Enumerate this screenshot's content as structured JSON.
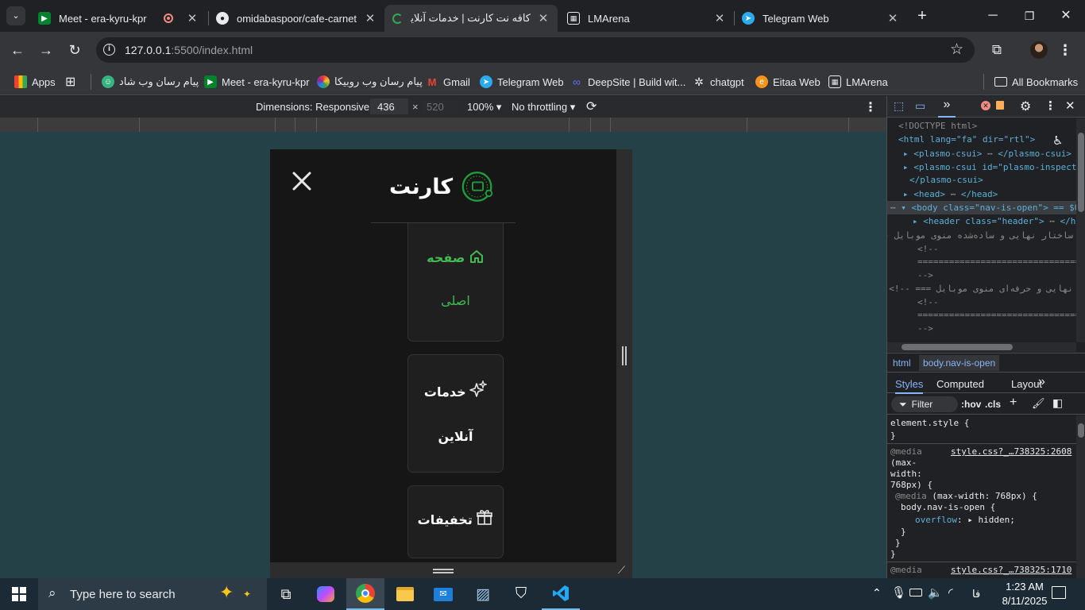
{
  "tabs": [
    {
      "title": "Meet - era-kyru-kpr",
      "icon": "google-meet-icon",
      "active": false
    },
    {
      "title": "omidabaspoor/cafe-carnet",
      "icon": "github-icon",
      "active": false
    },
    {
      "title": "کافه نت کارنت | خدمات آنلاین",
      "icon": "loading-icon",
      "active": true
    },
    {
      "title": "LMArena",
      "icon": "lmarena-icon",
      "active": false
    },
    {
      "title": "Telegram Web",
      "icon": "telegram-icon",
      "active": false
    }
  ],
  "toolbar": {
    "url_host": "127.0.0.1",
    "url_path": ":5500/index.html"
  },
  "bookmarks": {
    "apps_label": "Apps",
    "items": [
      {
        "label": "پیام رسان وب شاد",
        "icon": "shad-icon"
      },
      {
        "label": "Meet - era-kyru-kpr",
        "icon": "google-meet-icon"
      },
      {
        "label": "پیام رسان وب روبیکا",
        "icon": "rubika-icon"
      },
      {
        "label": "Gmail",
        "icon": "gmail-icon"
      },
      {
        "label": "Telegram Web",
        "icon": "telegram-icon"
      },
      {
        "label": "DeepSite | Build wit...",
        "icon": "deepsite-icon"
      },
      {
        "label": "chatgpt",
        "icon": "openai-icon"
      },
      {
        "label": "Eitaa Web",
        "icon": "eitaa-icon"
      },
      {
        "label": "LMArena",
        "icon": "lmarena-icon"
      }
    ],
    "all_label": "All Bookmarks"
  },
  "device_toolbar": {
    "dimensions_label": "Dimensions: Responsive",
    "width": "436",
    "height": "520",
    "zoom": "100%",
    "throttling": "No throttling"
  },
  "site": {
    "logo_text": "کارنت",
    "nav": [
      {
        "label_line1": "صفحه",
        "label_line2": "اصلی",
        "icon": "home-icon",
        "active": true
      },
      {
        "label_line1": "خدمات",
        "label_line2": "آنلاین",
        "icon": "sparkles-icon",
        "active": false
      },
      {
        "label_line1": "تخفیفات",
        "label_line2": "",
        "icon": "gift-icon",
        "active": false
      }
    ],
    "accent_color": "#3fb950"
  },
  "devtools": {
    "dom": {
      "doctype": "<!DOCTYPE html>",
      "html_tag": "<html lang=\"fa\" dir=\"rtl\">",
      "plasmo1": "<plasmo-csui>",
      "plasmo1_end": "</plasmo-csui>",
      "plasmo2": "<plasmo-csui id=\"plasmo-inspecto",
      "plasmo2_end": "</plasmo-csui>",
      "head": "<head>",
      "head_end": "</head>",
      "body": "<body class=\"nav-is-open\"> == $0",
      "header": "<header class=\"header\">",
      "header_end": "</he",
      "comment1": "ساختار نهایی و ساده‌شده منوی موبایل --!>",
      "comment2": "<!--",
      "comment3": "================================",
      "comment4": "-->",
      "comment5": "نهایی و حرفه‌ای منوی موبایل === --!>",
      "comment6": "<!--",
      "comment7": "================================",
      "comment8": "-->"
    },
    "breadcrumb": [
      "html",
      "body.nav-is-open"
    ],
    "panel_tabs": [
      "Styles",
      "Computed",
      "Layout"
    ],
    "filter_placeholder": "Filter",
    "hov": ":hov",
    "cls": ".cls",
    "styles": {
      "element_style": "element.style {",
      "close_brace": "}",
      "media1": "@media",
      "media1_q": "(max-",
      "media1_q2": "width:",
      "media1_q3": "768px) {",
      "source1": "style.css?_…738325:2608",
      "media2": "@media (max-width: 768px) {",
      "selector": "body.nav-is-open {",
      "prop": "overflow",
      "propval": "hidden;",
      "source2": "style.css?_…738325:1710",
      "media3": "@media"
    }
  },
  "taskbar": {
    "search_placeholder": "Type here to search",
    "time": "1:23 AM",
    "date": "8/11/2025",
    "lang": "فا"
  }
}
